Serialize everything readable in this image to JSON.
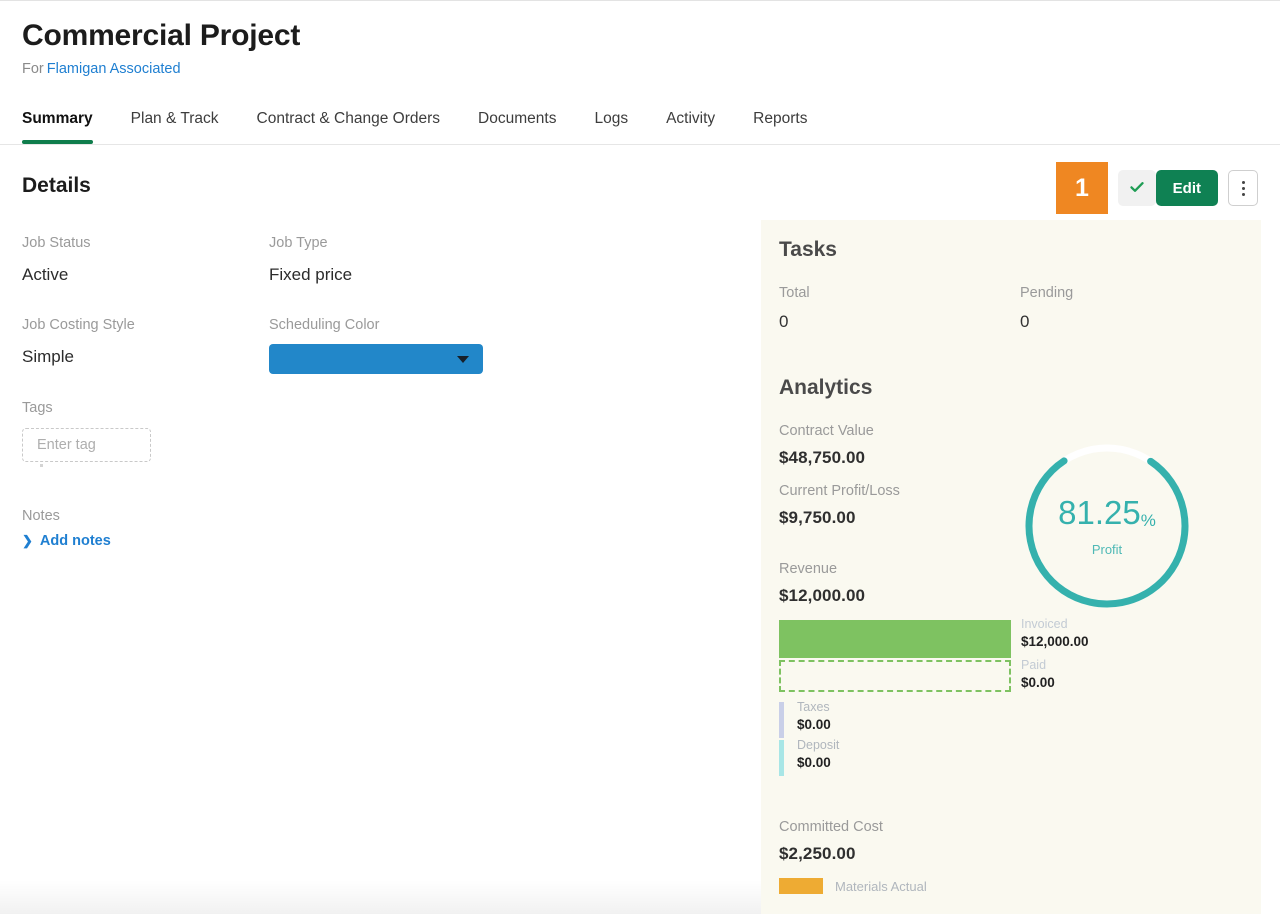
{
  "header": {
    "title": "Commercial Project",
    "for_label": "For",
    "client": "Flamigan Associated"
  },
  "tabs": [
    {
      "label": "Summary",
      "active": true
    },
    {
      "label": "Plan & Track",
      "active": false
    },
    {
      "label": "Contract & Change Orders",
      "active": false
    },
    {
      "label": "Documents",
      "active": false
    },
    {
      "label": "Logs",
      "active": false
    },
    {
      "label": "Activity",
      "active": false
    },
    {
      "label": "Reports",
      "active": false
    }
  ],
  "toolbar": {
    "highlight_number": "1",
    "check_icon": "check-icon",
    "edit_label": "Edit",
    "more_icon": "kebab-menu-icon",
    "highlight_color": "#ef8722",
    "edit_color": "#0f8153"
  },
  "details": {
    "heading": "Details",
    "job_status_label": "Job Status",
    "job_status_value": "Active",
    "job_type_label": "Job Type",
    "job_type_value": "Fixed price",
    "job_costing_style_label": "Job Costing Style",
    "job_costing_style_value": "Simple",
    "scheduling_color_label": "Scheduling Color",
    "scheduling_color_value": "#2287c9",
    "tags_label": "Tags",
    "tags_placeholder": "Enter tag",
    "tags_value": "",
    "notes_label": "Notes",
    "add_notes_label": "Add notes"
  },
  "sidebar": {
    "tasks": {
      "heading": "Tasks",
      "total_label": "Total",
      "total_value": "0",
      "pending_label": "Pending",
      "pending_value": "0"
    },
    "analytics": {
      "heading": "Analytics",
      "contract_value_label": "Contract Value",
      "contract_value": "$48,750.00",
      "profit_loss_label": "Current Profit/Loss",
      "profit_loss_value": "$9,750.00",
      "revenue_label": "Revenue",
      "revenue_value": "$12,000.00",
      "committed_cost_label": "Committed Cost",
      "committed_cost_value": "$2,250.00",
      "materials_actual_label": "Materials Actual"
    }
  },
  "chart_data": [
    {
      "type": "pie",
      "title": "Profit",
      "labels": [
        "Profit",
        "Remainder"
      ],
      "values": [
        81.25,
        18.75
      ],
      "display_value": "81.25",
      "display_unit": "%",
      "display_sub": "Profit",
      "colors": [
        "#35b1ad",
        "#ffffff"
      ],
      "donut": true
    },
    {
      "type": "bar",
      "title": "Revenue",
      "orientation": "horizontal",
      "categories": [
        "Invoiced",
        "Paid",
        "Taxes",
        "Deposit"
      ],
      "values": [
        12000.0,
        0.0,
        0.0,
        0.0
      ],
      "value_labels": [
        "$12,000.00",
        "$0.00",
        "$0.00",
        "$0.00"
      ],
      "colors": [
        "#7ec261",
        "#7ec261",
        "#c9cfe8",
        "#a8e6e6"
      ],
      "styles": [
        "filled",
        "dashed-outline",
        "filled",
        "filled"
      ],
      "total": 12000.0,
      "ylabel": "",
      "xlabel": "",
      "grid": false,
      "legend": "right"
    },
    {
      "type": "bar",
      "title": "Committed Cost",
      "categories": [
        "Materials Actual"
      ],
      "values": [
        2250.0
      ],
      "value_labels": [
        "$2,250.00"
      ],
      "colors": [
        "#eeab33"
      ],
      "legend": "bottom"
    }
  ]
}
